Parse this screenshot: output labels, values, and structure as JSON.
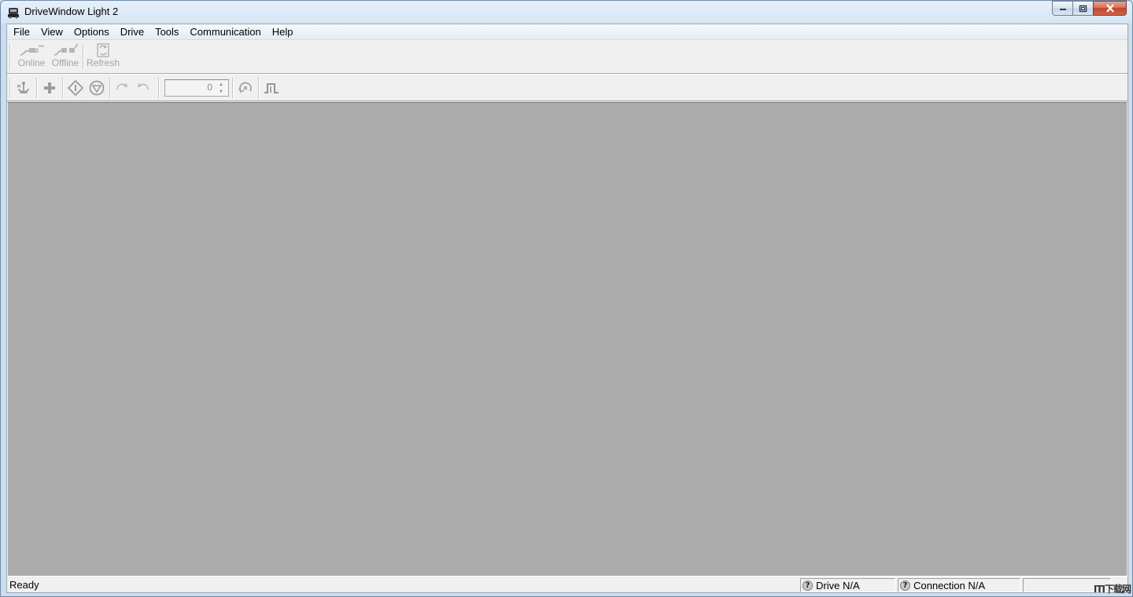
{
  "window": {
    "title": "DriveWindow Light 2"
  },
  "menu": [
    {
      "label": "File"
    },
    {
      "label": "View"
    },
    {
      "label": "Options"
    },
    {
      "label": "Drive"
    },
    {
      "label": "Tools"
    },
    {
      "label": "Communication"
    },
    {
      "label": "Help"
    }
  ],
  "toolbar_main": {
    "online_label": "Online",
    "offline_label": "Offline",
    "refresh_label": "Refresh"
  },
  "toolbar_drive": {
    "reference_value": "0",
    "icons": [
      "local-control-icon",
      "add-icon",
      "start-icon",
      "stop-icon",
      "rotate-forward-icon",
      "rotate-reverse-icon",
      "reset-icon",
      "step-icon"
    ]
  },
  "status": {
    "ready": "Ready",
    "drive": "Drive N/A",
    "connection": "Connection N/A"
  },
  "watermark": "ITI下载网",
  "colors": {
    "workspace": "#ababab",
    "chrome": "#f0f0f0",
    "disabled_text": "#a4a4a4"
  }
}
